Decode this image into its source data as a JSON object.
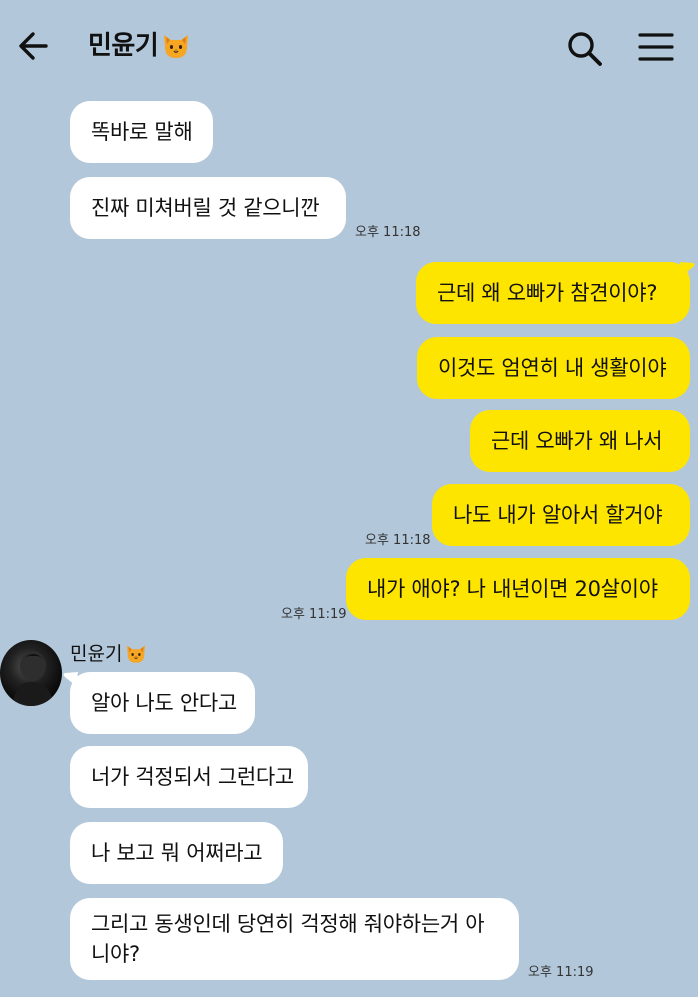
{
  "header": {
    "title": "민윤기",
    "title_emoji": "cat-face-icon",
    "back_icon": "back-arrow-icon",
    "search_icon": "search-icon",
    "menu_icon": "menu-icon"
  },
  "colors": {
    "background": "#B2C7DA",
    "incoming_bubble": "#FFFFFF",
    "outgoing_bubble": "#FEE500"
  },
  "messages": [
    {
      "direction": "in",
      "text": "똑바로 말해"
    },
    {
      "direction": "in",
      "text": "진짜 미쳐버릴 것 같으니깐",
      "time": "오후 11:18"
    },
    {
      "direction": "out",
      "text": "근데 왜 오빠가 참견이야?"
    },
    {
      "direction": "out",
      "text": "이것도 엄연히 내 생활이야"
    },
    {
      "direction": "out",
      "text": "근데 오빠가 왜 나서"
    },
    {
      "direction": "out",
      "text": "나도 내가 알아서 할거야",
      "time": "오후 11:18"
    },
    {
      "direction": "out",
      "text": "내가 애야? 나 내년이면 20살이야",
      "time": "오후 11:19"
    },
    {
      "direction": "in",
      "sender": "민윤기",
      "text": "알아 나도 안다고"
    },
    {
      "direction": "in",
      "text": "너가 걱정되서 그런다고"
    },
    {
      "direction": "in",
      "text": "나 보고 뭐 어쩌라고"
    },
    {
      "direction": "in",
      "text": "그리고 동생인데 당연히 걱정해 줘야하는거 아니야?",
      "time": "오후 11:19"
    }
  ]
}
